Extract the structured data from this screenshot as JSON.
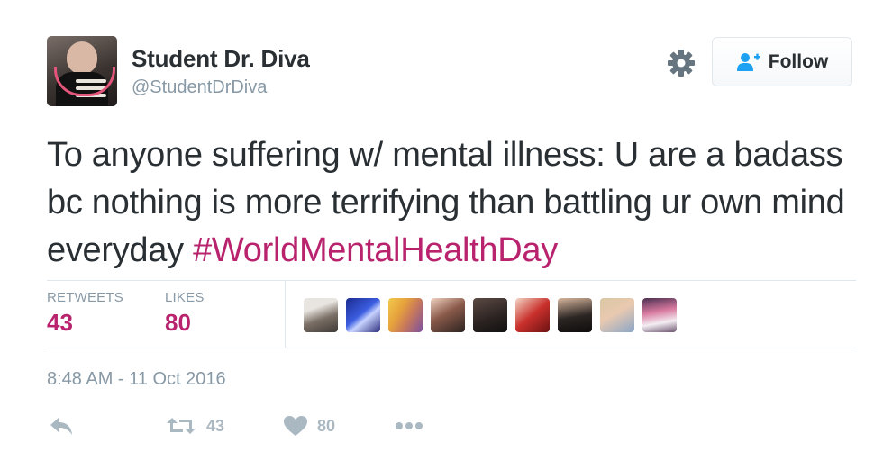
{
  "tweet": {
    "author": {
      "display_name": "Student Dr. Diva",
      "handle": "@StudentDrDiva"
    },
    "follow_label": "Follow",
    "text": "To anyone suffering w/ mental illness: U are a badass bc nothing is more terrifying than battling ur own mind everyday ",
    "hashtag": "#WorldMentalHealthDay",
    "stats": {
      "retweets_label": "RETWEETS",
      "retweets": "43",
      "likes_label": "LIKES",
      "likes": "80"
    },
    "timestamp": "8:48 AM - 11 Oct 2016",
    "actions": {
      "reply_icon": "reply-icon",
      "retweet_icon": "retweet-icon",
      "retweet_count": "43",
      "like_icon": "heart-icon",
      "like_count": "80",
      "more_icon": "more-icon"
    }
  },
  "colors": {
    "accent": "#b9236e",
    "muted": "#8899a6",
    "action_gray": "#aab8c2",
    "text": "#292f33",
    "follow_icon": "#1da1f2"
  }
}
